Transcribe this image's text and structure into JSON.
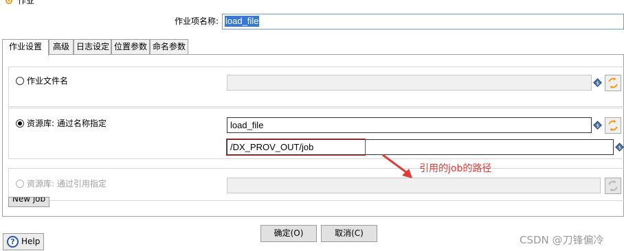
{
  "window": {
    "title": "作业"
  },
  "job_name": {
    "label": "作业项名称:",
    "value": "load_file"
  },
  "tabs": [
    {
      "label": "作业设置"
    },
    {
      "label": "高级"
    },
    {
      "label": "日志设定"
    },
    {
      "label": "位置参数"
    },
    {
      "label": "命名参数"
    }
  ],
  "options": {
    "job_file": {
      "label": "作业文件名",
      "value": ""
    },
    "repo_by_name": {
      "label": "资源库: 通过名称指定",
      "name_value": "load_file",
      "path_value": "/DX_PROV_OUT/job"
    },
    "repo_by_ref": {
      "label": "资源库: 通过引用指定",
      "value": ""
    },
    "new_job_label": "New job",
    "variable_icon_glyph": "$"
  },
  "annotation": {
    "text": "引用的job的路径",
    "color": "#e53935"
  },
  "buttons": {
    "ok": "确定(O)",
    "cancel": "取消(C)",
    "help": "Help",
    "help_glyph": "?"
  },
  "watermark": "CSDN @刀锋偏冷",
  "icons": {
    "app": "gear-icon",
    "variable": "variable-diamond-icon",
    "browse": "browse-repository-icon",
    "arrow": "red-arrow-icon"
  }
}
